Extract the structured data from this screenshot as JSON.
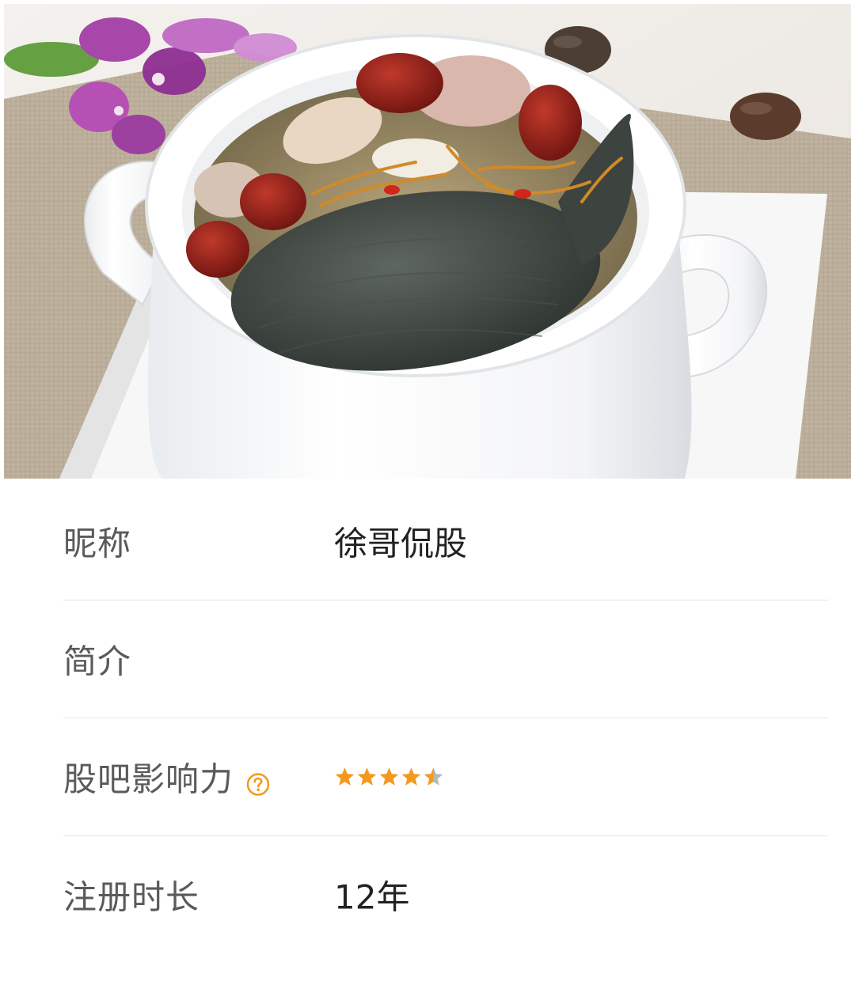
{
  "cover": {
    "icon": "cover-photo"
  },
  "profile": {
    "rows": [
      {
        "label": "昵称",
        "value": "徐哥侃股"
      },
      {
        "label": "简介",
        "value": ""
      },
      {
        "label": "股吧影响力",
        "help_icon": "question-circle-icon",
        "rating": 4.5,
        "rating_max": 5
      },
      {
        "label": "注册时长",
        "value": "12年"
      }
    ]
  },
  "colors": {
    "accent": "#f39a1e",
    "star_empty": "#b8b8b8",
    "label": "#5a5a5a",
    "value": "#222222",
    "divider": "#e6e6e6"
  }
}
